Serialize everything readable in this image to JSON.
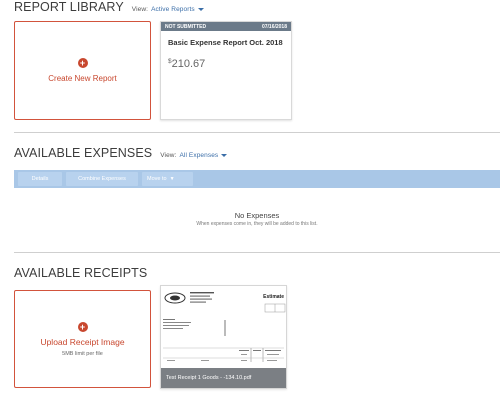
{
  "report_library": {
    "title": "REPORT LIBRARY",
    "view_label": "View:",
    "view_value": "Active Reports"
  },
  "create_report": {
    "label": "Create New Report",
    "icon": "plus-circle-icon"
  },
  "report_card": {
    "status": "NOT SUBMITTED",
    "date": "07/16/2018",
    "name": "Basic Expense Report Oct. 2018",
    "currency": "$",
    "amount": "210.67",
    "status_color": "#6b7a89"
  },
  "available_expenses": {
    "title": "AVAILABLE EXPENSES",
    "view_label": "View:",
    "view_value": "All Expenses",
    "toolbar": {
      "details_label": "Details",
      "combine_label": "Combine Expenses",
      "move_label": "Move to"
    },
    "empty_title": "No Expenses",
    "empty_subtitle": "When expenses come in, they will be added to this list."
  },
  "available_receipts": {
    "title": "AVAILABLE RECEIPTS",
    "upload_label": "Upload Receipt Image",
    "upload_hint": "5MB limit per file",
    "upload_icon": "plus-circle-icon",
    "receipt_caption": "Test Receipt 1 Goods - -134.10.pdf",
    "receipt_title": "Estimate"
  },
  "colors": {
    "accent": "#c8472e",
    "link": "#3b6ea8",
    "toolbar": "#a9c7e7"
  }
}
